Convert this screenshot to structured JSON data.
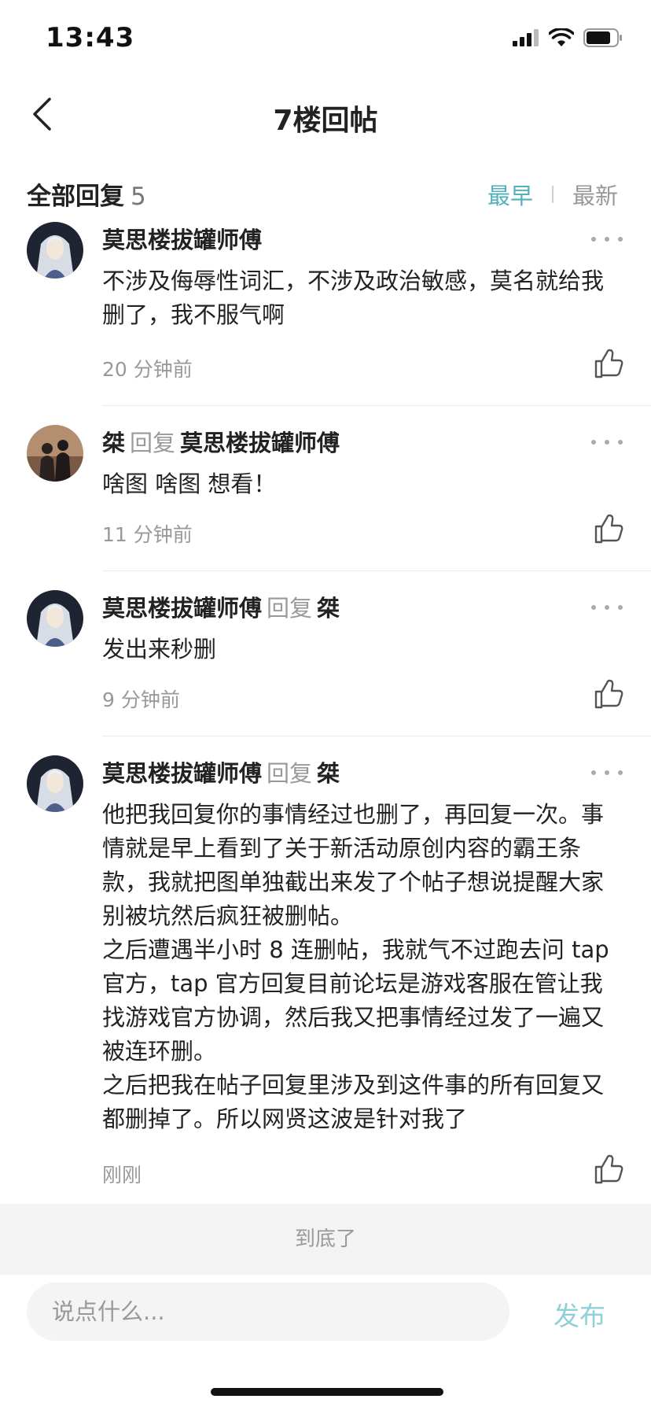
{
  "status_bar": {
    "time": "13:43"
  },
  "nav": {
    "title": "7楼回帖"
  },
  "replies_header": {
    "title": "全部回复",
    "count": "5",
    "sort_options": [
      "最早",
      "最新"
    ],
    "active_sort": "最早"
  },
  "replies": [
    {
      "author": "莫思楼拔罐师傅",
      "reply_verb": "",
      "reply_to": "",
      "lines": [
        "不涉及侮辱性词汇，不涉及政治敏感，莫名就给我删了，我不服气啊"
      ],
      "time": "20 分钟前",
      "avatar": "anime-avatar"
    },
    {
      "author": "桀",
      "reply_verb": "回复",
      "reply_to": "莫思楼拔罐师傅",
      "lines": [
        "啥图 啥图 想看！"
      ],
      "time": "11 分钟前",
      "avatar": "photo-avatar"
    },
    {
      "author": "莫思楼拔罐师傅",
      "reply_verb": "回复",
      "reply_to": "桀",
      "lines": [
        "发出来秒删"
      ],
      "time": "9 分钟前",
      "avatar": "anime-avatar"
    },
    {
      "author": "莫思楼拔罐师傅",
      "reply_verb": "回复",
      "reply_to": "桀",
      "lines": [
        "他把我回复你的事情经过也删了，再回复一次。事情就是早上看到了关于新活动原创内容的霸王条款，我就把图单独截出来发了个帖子想说提醒大家别被坑然后疯狂被删帖。",
        "之后遭遇半小时 8 连删帖，我就气不过跑去问 tap 官方，tap 官方回复目前论坛是游戏客服在管让我找游戏官方协调，然后我又把事情经过发了一遍又被连环删。",
        "之后把我在帖子回复里涉及到这件事的所有回复又都删掉了。所以网贤这波是针对我了"
      ],
      "time": "刚刚",
      "avatar": "anime-avatar"
    }
  ],
  "footer": {
    "end_text": "到底了",
    "input_placeholder": "说点什么...",
    "publish_label": "发布"
  },
  "colors": {
    "accent": "#4fb1bb",
    "publish_disabled": "#8fd0d7",
    "muted_text": "#999999"
  }
}
